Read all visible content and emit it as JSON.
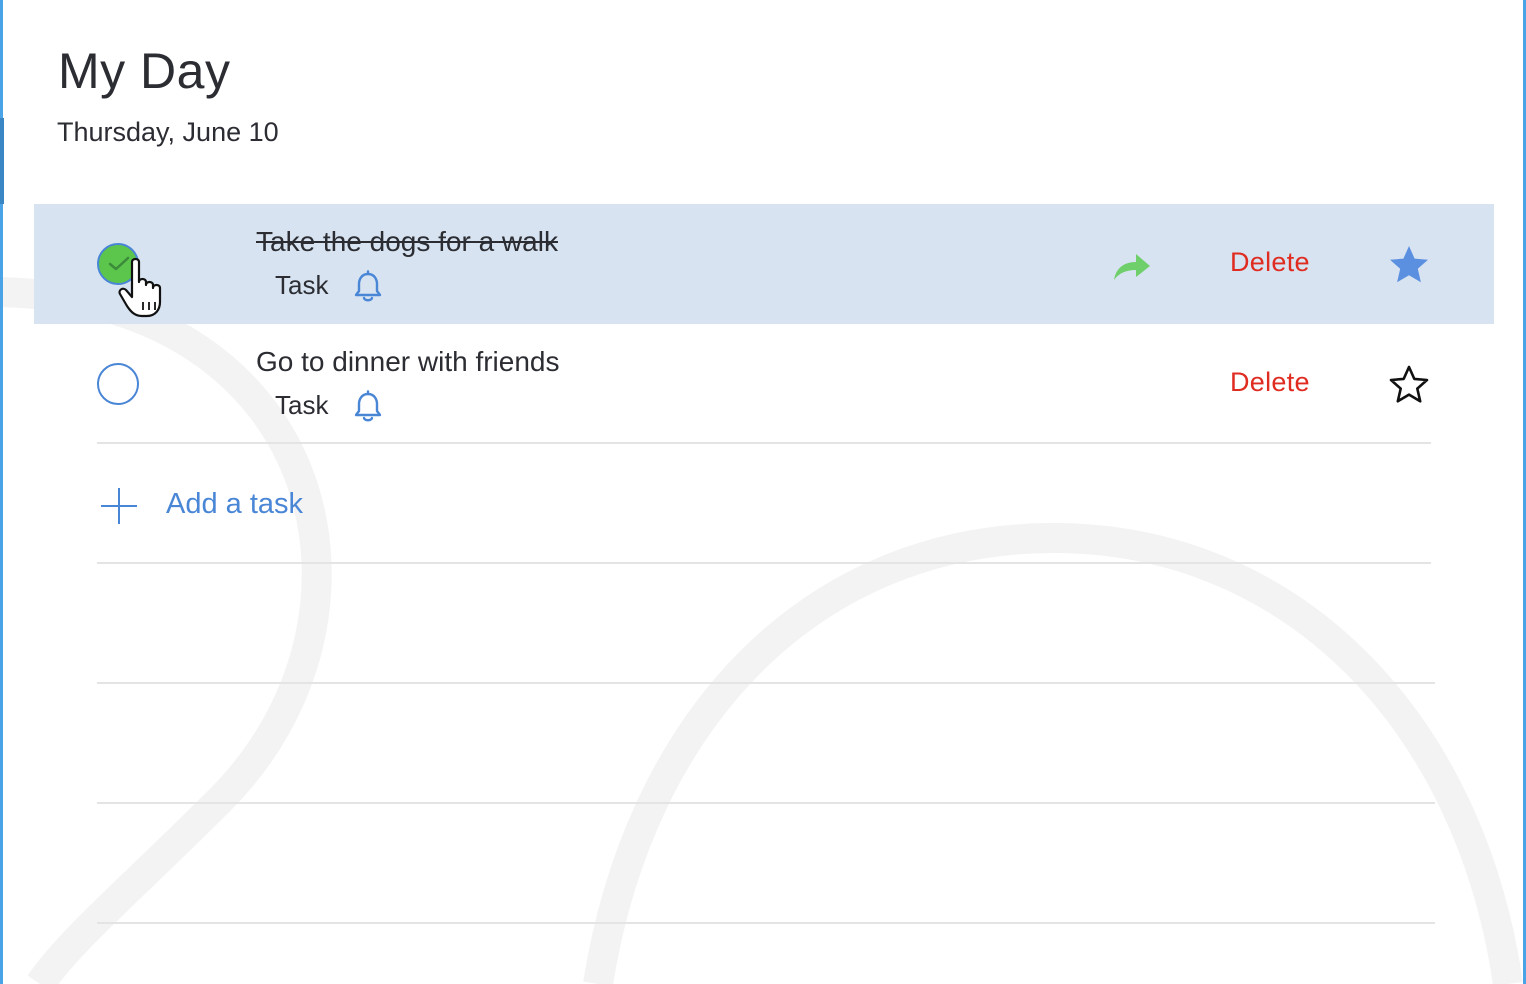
{
  "header": {
    "title": "My Day",
    "date": "Thursday, June 10"
  },
  "tasks": [
    {
      "title": "Take the dogs for a walk",
      "type": "Task",
      "completed": true,
      "selected": true,
      "starred": true,
      "delete_label": "Delete",
      "icons": [
        "checkbox-checked-icon",
        "bell-icon",
        "move-arrow-icon",
        "star-filled-icon"
      ]
    },
    {
      "title": "Go to dinner with friends",
      "type": "Task",
      "completed": false,
      "selected": false,
      "starred": false,
      "delete_label": "Delete",
      "icons": [
        "checkbox-empty-icon",
        "bell-icon",
        "star-outline-icon"
      ]
    }
  ],
  "add_task": {
    "label": "Add a task",
    "icon": "plus-icon"
  },
  "colors": {
    "accent_blue": "#4a86d6",
    "complete_green": "#5cc54b",
    "delete_red": "#e02b20",
    "selected_row": "#d7e3f0",
    "window_edge": "#4aa3e6"
  }
}
